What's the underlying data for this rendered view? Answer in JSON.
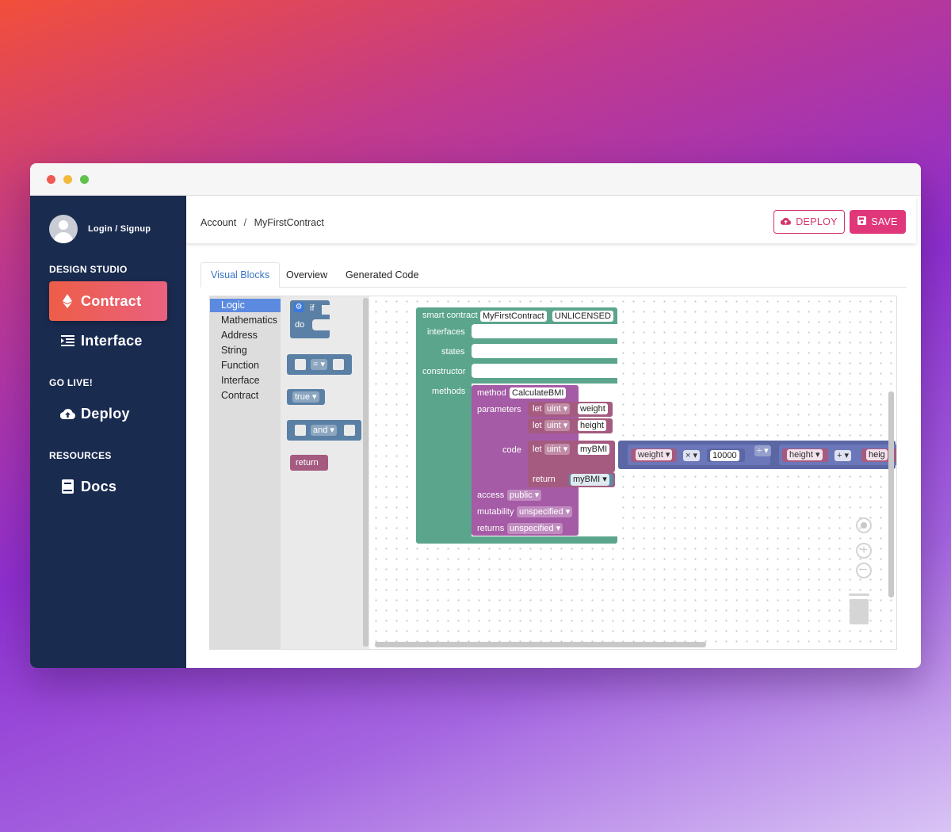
{
  "sidebar": {
    "login_label": "Login / Signup",
    "design_section": "DESIGN STUDIO",
    "contract_label": "Contract",
    "interface_label": "Interface",
    "golive_section": "GO LIVE!",
    "deploy_label": "Deploy",
    "resources_section": "RESOURCES",
    "docs_label": "Docs"
  },
  "header": {
    "breadcrumb_root": "Account",
    "breadcrumb_separator": "/",
    "breadcrumb_current": "MyFirstContract",
    "deploy_button": "DEPLOY",
    "save_button": "SAVE"
  },
  "tabs": [
    {
      "label": "Visual Blocks",
      "active": true
    },
    {
      "label": "Overview",
      "active": false
    },
    {
      "label": "Generated Code",
      "active": false
    }
  ],
  "toolbox": {
    "categories": [
      "Logic",
      "Mathematics",
      "Address",
      "String",
      "Function",
      "Interface",
      "Contract"
    ],
    "selected": "Logic"
  },
  "flyout": {
    "if_label": "if",
    "do_label": "do",
    "compare_op": "= ▾",
    "bool_value": "true ▾",
    "and_op": "and ▾",
    "return_label": "return"
  },
  "contract_block": {
    "title_label": "smart contract",
    "name": "MyFirstContract",
    "license": "UNLICENSED",
    "interfaces_label": "interfaces",
    "states_label": "states",
    "constructor_label": "constructor",
    "methods_label": "methods"
  },
  "method_block": {
    "method_label": "method",
    "method_name": "CalculateBMI",
    "parameters_label": "parameters",
    "param1": {
      "let": "let",
      "type": "uint ▾",
      "name": "weight"
    },
    "param2": {
      "let": "let",
      "type": "uint ▾",
      "name": "height"
    },
    "code_label": "code",
    "code_let": {
      "let": "let",
      "type": "uint ▾",
      "name": "myBMI"
    },
    "expr": {
      "weight": "weight ▾",
      "times": "× ▾",
      "constant": "10000",
      "divide": "÷ ▾",
      "height": "height ▾",
      "plus": "+ ▾",
      "height_cut": "heig"
    },
    "return_label": "return",
    "return_value": "myBMI ▾",
    "access_label": "access",
    "access_value": "public ▾",
    "mutability_label": "mutability",
    "mutability_value": "unspecified ▾",
    "returns_label": "returns",
    "returns_value": "unspecified ▾"
  },
  "colors": {
    "sidebar_bg": "#1a2b50",
    "accent": "#e0367a",
    "contract_green": "#5ba58c",
    "method_purple": "#a55ba5",
    "logic_blue": "#5b80a5"
  }
}
